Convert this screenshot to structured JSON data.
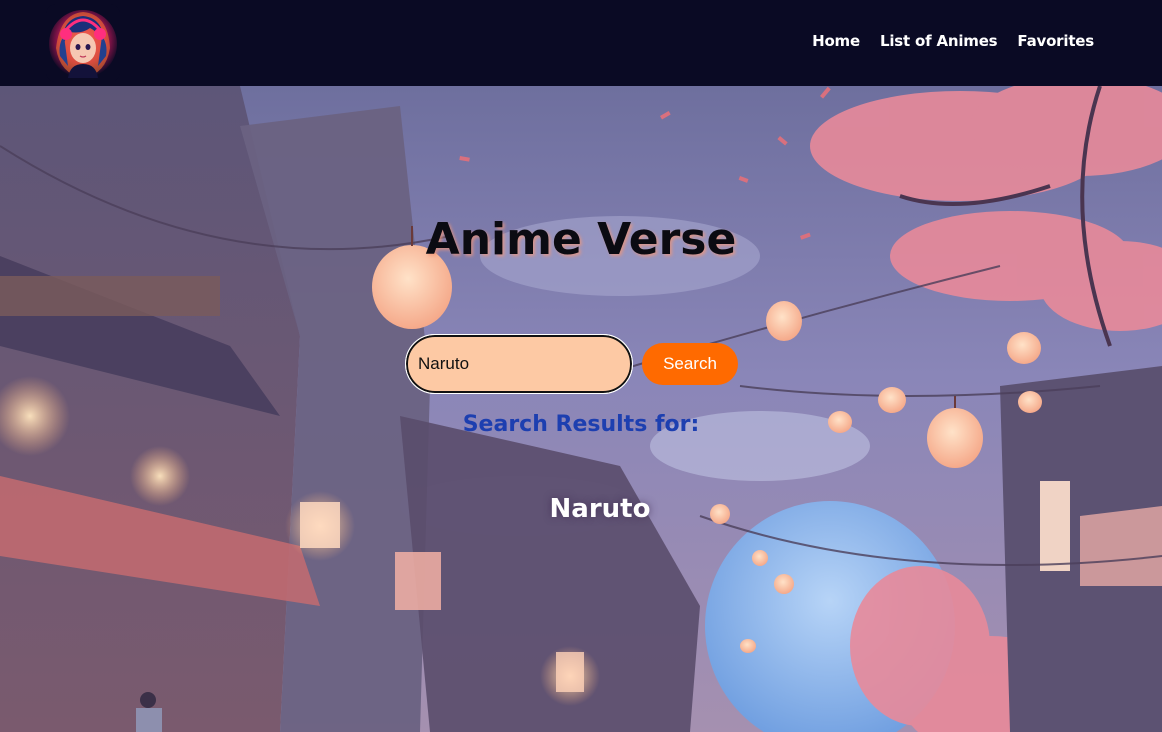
{
  "navbar": {
    "logo_icon": "anime-girl-avatar-icon",
    "links": [
      {
        "label": "Home"
      },
      {
        "label": "List of Animes"
      },
      {
        "label": "Favorites"
      }
    ],
    "background": "#0a0a24"
  },
  "hero": {
    "title": "Anime Verse",
    "background_scene": "anime-street-lanterns-cherry-blossoms-moon"
  },
  "search": {
    "value": "Naruto",
    "button_label": "Search",
    "input_color": "#fdc9a4",
    "button_color": "#ff6a00"
  },
  "results": {
    "heading": "Search Results for:",
    "items": [
      {
        "title": "Naruto"
      }
    ],
    "heading_color": "#1d3fb0"
  }
}
